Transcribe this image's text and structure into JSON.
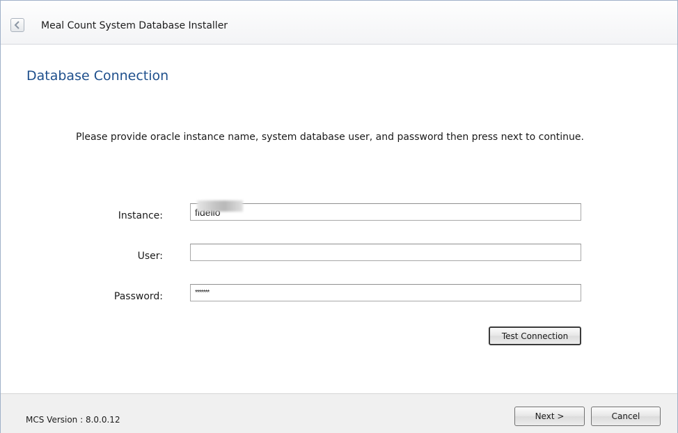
{
  "window": {
    "title": "Meal Count System Database Installer",
    "back_icon": "chevron-left-icon"
  },
  "page": {
    "heading": "Database Connection",
    "instructions": "Please provide oracle instance name, system database user, and password then press next to continue."
  },
  "form": {
    "instance": {
      "label": "Instance:",
      "value": "fidelio"
    },
    "user": {
      "label": "User:",
      "value": ""
    },
    "password": {
      "label": "Password:",
      "value": "*******"
    },
    "test_connection_label": "Test Connection"
  },
  "footer": {
    "version": "MCS Version : 8.0.0.12",
    "next_label": "Next >",
    "cancel_label": "Cancel"
  },
  "colors": {
    "heading": "#1e4f8c",
    "footer_bg": "#f0f0f0"
  }
}
